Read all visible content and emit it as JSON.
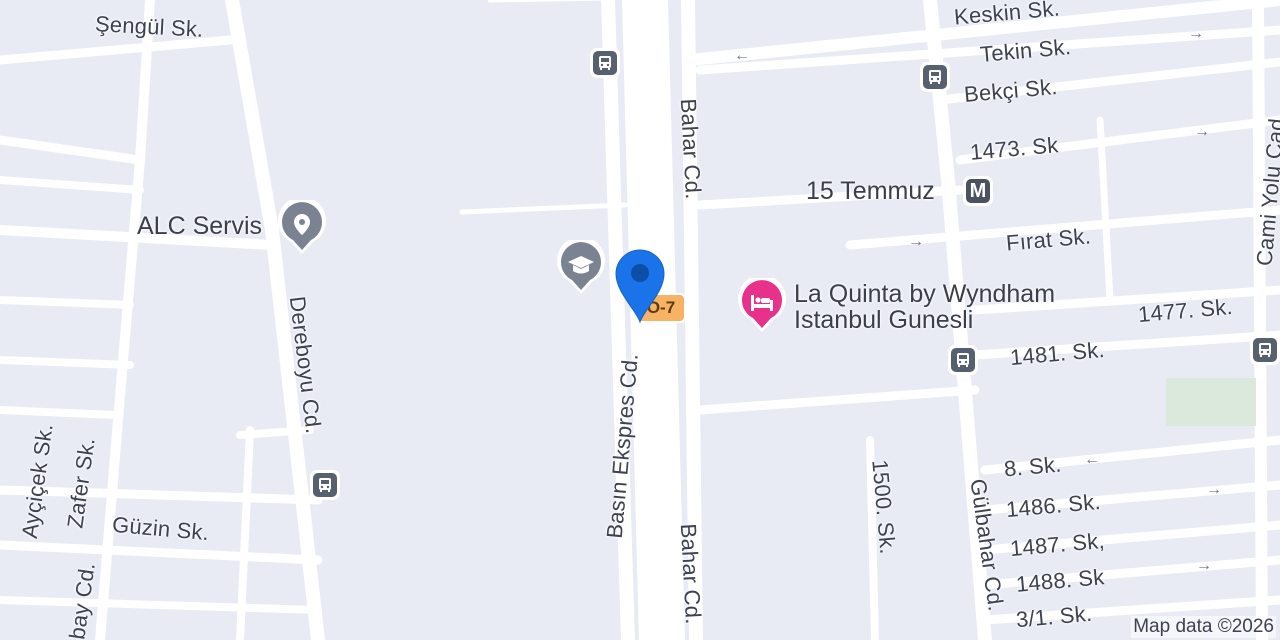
{
  "map": {
    "streets": {
      "sengul": "Şengül Sk.",
      "keskin": "Keskin Sk.",
      "tekin": "Tekin Sk.",
      "bekci": "Bekçi Sk.",
      "s1473": "1473. Sk",
      "firat": "Fırat Sk.",
      "s1477": "1477. Sk.",
      "s1481": "1481. Sk.",
      "s8": "8. Sk.",
      "s1486": "1486. Sk.",
      "s1487": "1487. Sk,",
      "s1488": "1488. Sk",
      "s31": "3/1. Sk.",
      "bahar_top": "Bahar Cd.",
      "bahar_bottom": "Bahar Cd.",
      "basin_ekspres": "Basın Ekspres Cd.",
      "dereboyu": "Dereboyu Cd.",
      "aycicek": "Ayçiçek Sk.",
      "zafer": "Zafer Sk.",
      "guzin": "Güzin Sk.",
      "bay_cd": "bay Cd.",
      "s1500": "1500. Sk.",
      "gulbahar": "Gülbahar Cd.",
      "cami_yolu": "Cami Yolu Cad."
    },
    "pois": {
      "alc_servis": "ALC Servis",
      "metro_station": "15 Temmuz",
      "hotel_line1": "La Quinta by Wyndham",
      "hotel_line2": "Istanbul Gunesli"
    },
    "highway_shield": "O-7",
    "metro_letter": "M",
    "copyright": "Map data ©2026",
    "colors": {
      "background": "#e8eaf4",
      "road": "#ffffff",
      "location_pin": "#1a73e8",
      "hotel_pin": "#e8318a",
      "poi_pin": "#7b8393",
      "shield": "#f7b264",
      "park": "#dbe9dc"
    }
  }
}
